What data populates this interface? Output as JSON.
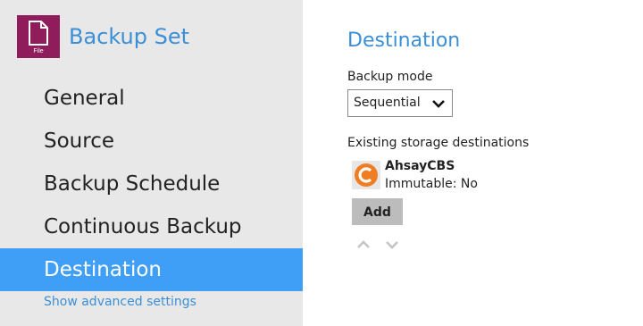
{
  "sidebar": {
    "app_icon": {
      "icon": "file-icon",
      "caption": "File",
      "color": "#8f1d5c"
    },
    "title": "Backup Set",
    "items": [
      {
        "label": "General",
        "active": false
      },
      {
        "label": "Source",
        "active": false
      },
      {
        "label": "Backup Schedule",
        "active": false
      },
      {
        "label": "Continuous Backup",
        "active": false
      },
      {
        "label": "Destination",
        "active": true
      }
    ],
    "advanced_link": "Show advanced settings",
    "active_color": "#3f9ef5"
  },
  "main": {
    "title": "Destination",
    "backup_mode": {
      "label": "Backup mode",
      "value": "Sequential"
    },
    "existing_label": "Existing storage destinations",
    "destinations": [
      {
        "name": "AhsayCBS",
        "status": "Immutable: No",
        "icon": "ahsay-logo-icon",
        "color": "#f07d22"
      }
    ],
    "add_label": "Add",
    "move_up_icon": "chevron-up-icon",
    "move_down_icon": "chevron-down-icon"
  }
}
